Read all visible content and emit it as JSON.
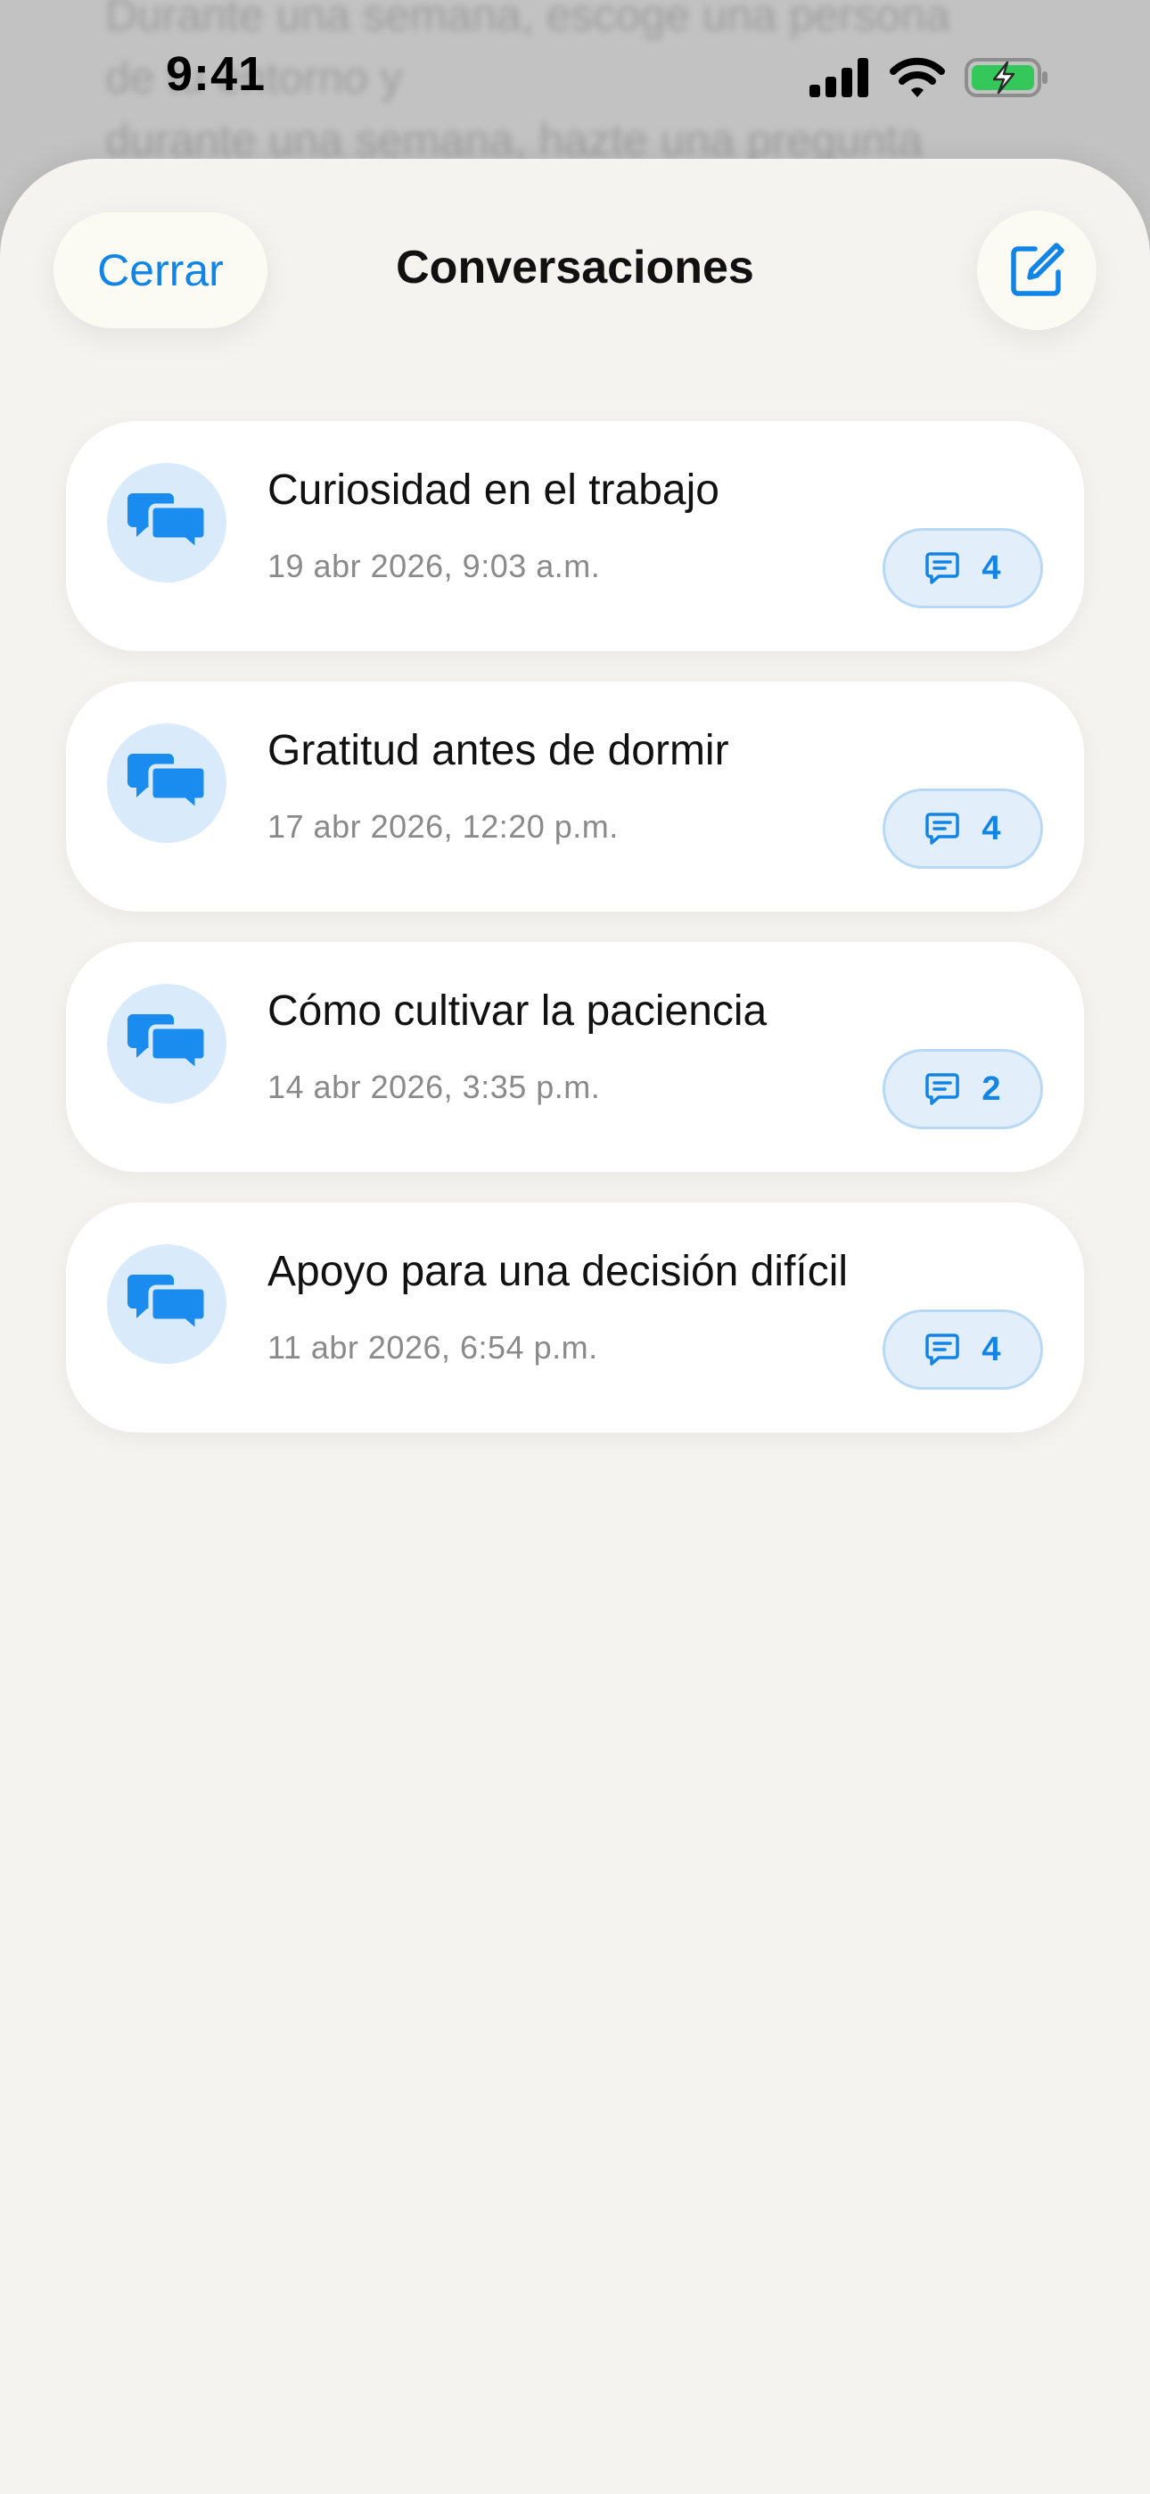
{
  "background": {
    "blurred_text": "Durante una semana, escoge una persona de tu entorno y\ndurante una semana, hazte una pregunta\nnueva cada día sobre ella: ¿quién la\ndirigió?, ¿qué pasaría si la hiciera al..."
  },
  "status_bar": {
    "time": "9:41"
  },
  "header": {
    "close_label": "Cerrar",
    "title": "Conversaciones"
  },
  "conversations": [
    {
      "title": "Curiosidad en el trabajo",
      "date": "19 abr 2026, 9:03 a.m.",
      "count": "4"
    },
    {
      "title": "Gratitud antes de dormir",
      "date": "17 abr 2026, 12:20 p.m.",
      "count": "4"
    },
    {
      "title": "Cómo cultivar la paciencia",
      "date": "14 abr 2026, 3:35 p.m.",
      "count": "2"
    },
    {
      "title": "Apoyo para una decisión difícil",
      "date": "11 abr 2026, 6:54 p.m.",
      "count": "4"
    }
  ],
  "icons": {
    "close": "text-button",
    "compose": "compose-icon",
    "conversation": "chat-bubbles-icon",
    "badge": "message-icon",
    "signal": "cellular-signal-icon",
    "wifi": "wifi-icon",
    "battery": "battery-charging-icon"
  },
  "colors": {
    "accent": "#1284e6",
    "sheet_background": "#f4f3ef",
    "icon_circle": "#d9eafb",
    "badge_background": "#e2effb",
    "battery_fill": "#34c759"
  }
}
